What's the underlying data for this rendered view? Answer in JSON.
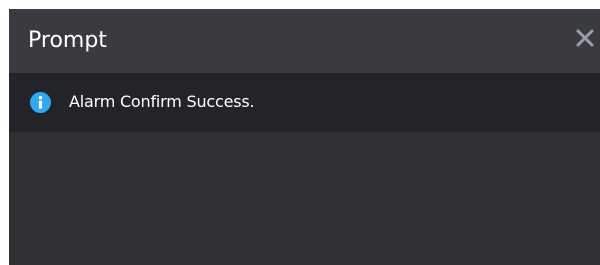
{
  "dialog": {
    "title": "Prompt",
    "close_icon": "close-icon",
    "message_icon": "info-icon",
    "message": "Alarm Confirm Success."
  },
  "colors": {
    "dialog_bg": "#2e3034",
    "titlebar_bg": "#393b40",
    "message_bar_bg": "#22242a",
    "info_icon": "#2fa8f0",
    "text": "#ffffff",
    "close_icon": "#9a9ea6"
  }
}
